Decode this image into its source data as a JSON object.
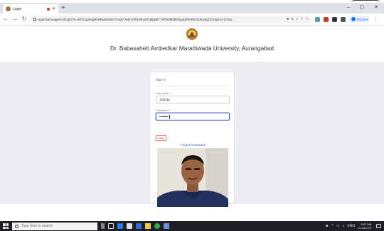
{
  "browser": {
    "tab_title": "Login",
    "new_tab": "+",
    "address": "sppl.bamuapps.in/login?n=nR7Lqp9ag8UMbasNUNYrcaZA7njY57ibHSnxUh1BgBGYzPvD9DbbDguqP9nkDzm3IqXgCmckprnA1CDa...",
    "profile_name": "Paused",
    "window_controls": [
      "–",
      "▢",
      "✕"
    ]
  },
  "header": {
    "university_name": "Dr. Babasaheb Ambedkar Marathwada University, Aurangabad"
  },
  "login": {
    "title": "Sign In",
    "username_label": "Username",
    "username_value": "10Dupc",
    "password_label": "Password",
    "password_value": "••••••••",
    "required_mark": "*",
    "login_button": "Login",
    "forgot_password": "Forgot Password"
  },
  "taskbar": {
    "search_placeholder": "Type here to search",
    "tray_lang": "ENG",
    "time": "9:57 AM",
    "date": "21-Dec-22"
  },
  "colors": {
    "page_bg": "#edeef1",
    "link": "#3b5bdb",
    "login_border": "#e57373"
  }
}
